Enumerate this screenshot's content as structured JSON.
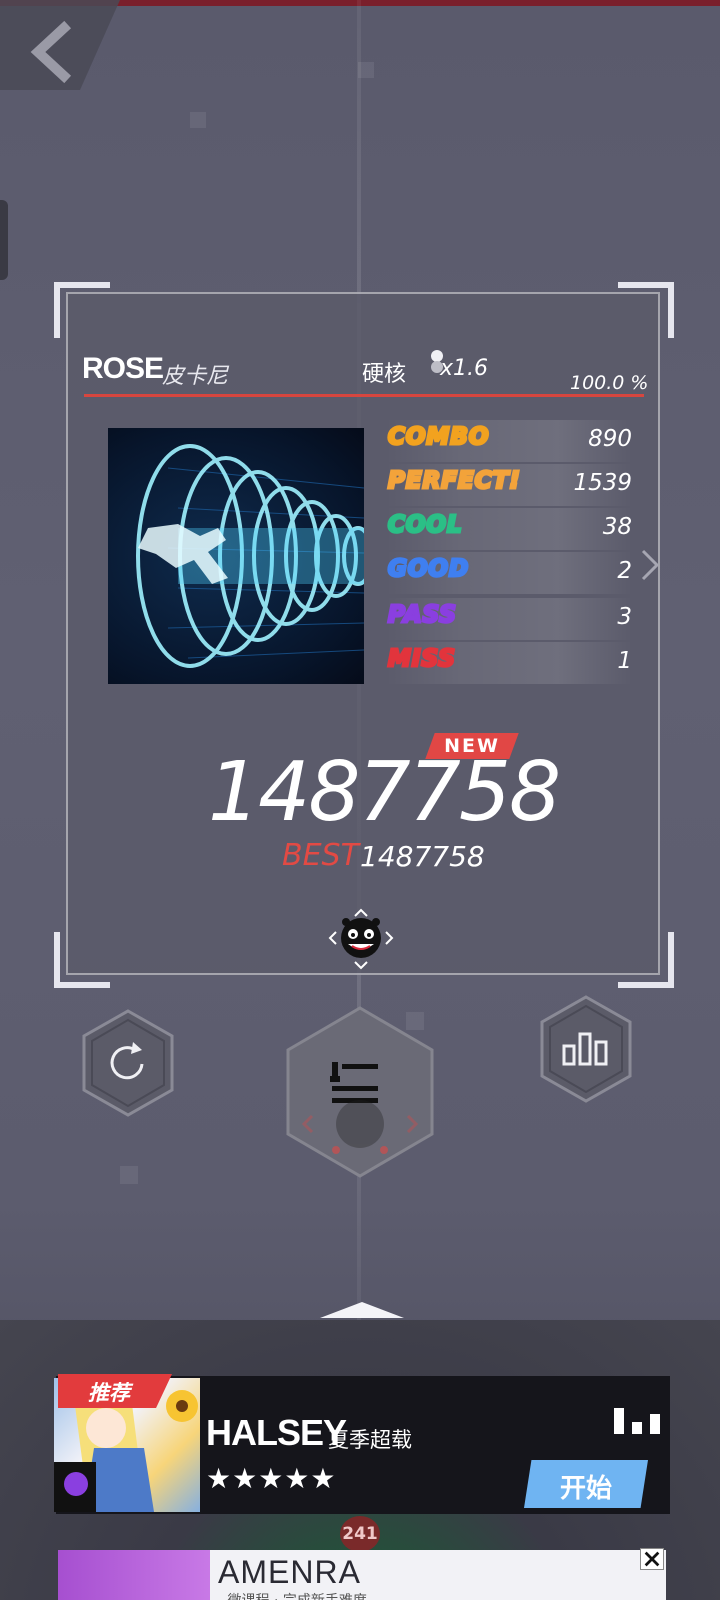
{
  "song": {
    "name": "ROSE",
    "artist": "皮卡尼",
    "difficulty": "硬核",
    "speed": "x1.6",
    "accuracy": "100.0 %"
  },
  "judgements": [
    {
      "label": "COMBO",
      "value": "890",
      "color": "#f2a21f"
    },
    {
      "label": "PERFECT!",
      "value": "1539",
      "color": "#f3a33a"
    },
    {
      "label": "COOL",
      "value": "38",
      "color": "#2bbf86"
    },
    {
      "label": "GOOD",
      "value": "2",
      "color": "#3f7ff0"
    },
    {
      "label": "PASS",
      "value": "3",
      "color": "#8a3fe0"
    },
    {
      "label": "MISS",
      "value": "1",
      "color": "#e2343c"
    }
  ],
  "result": {
    "new_badge": "NEW",
    "score": "1487758",
    "best_label": "BEST",
    "best_score": "1487758"
  },
  "recommend": {
    "tag": "推荐",
    "title": "HALSEY",
    "artist": "夏季超载",
    "stars": "★★★★★",
    "start_label": "开始",
    "count": "241"
  },
  "ad": {
    "title": "AMENRA",
    "subtitle": "- 微课程 · 完成新手难度"
  },
  "colors": {
    "accent_red": "#e14745",
    "start_blue": "#6fb4f2"
  }
}
